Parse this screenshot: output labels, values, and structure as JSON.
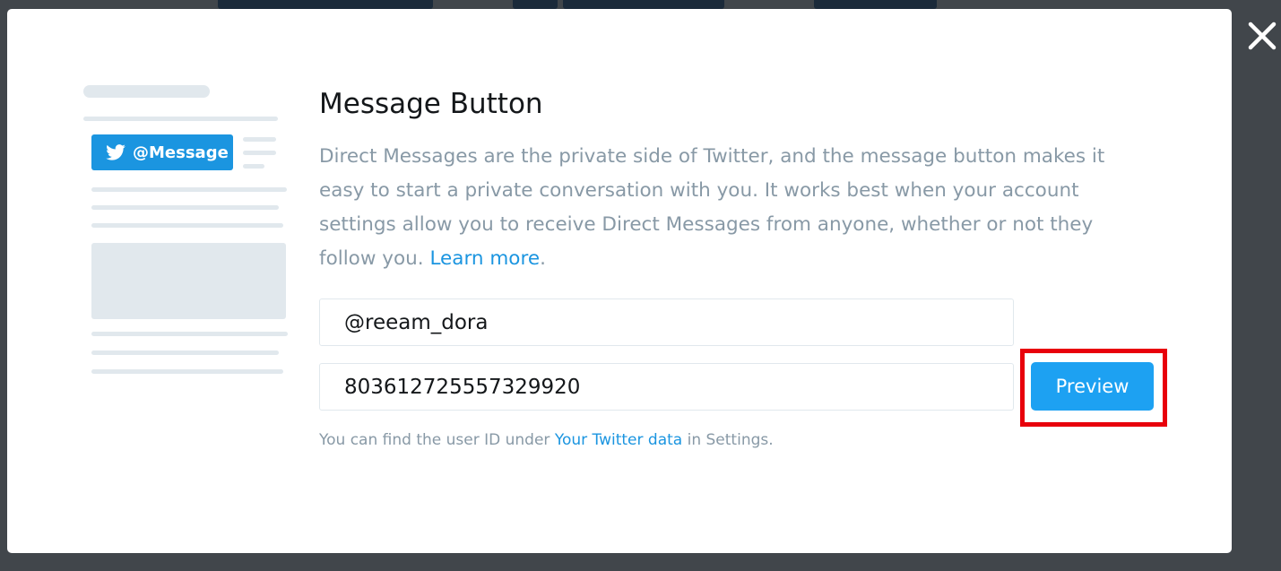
{
  "modal": {
    "title": "Message Button",
    "description": "Direct Messages are the private side of Twitter, and the message button makes it easy to start a private conversation with you. It works best when your account settings allow you to receive Direct Messages from anyone, whether or not they follow you.",
    "learn_more_label": "Learn more",
    "close_label": "×",
    "illustration": {
      "button_label": "@Message",
      "icon": "twitter-bird-icon"
    },
    "screen_name_field": {
      "value": "@reeam_dora"
    },
    "user_id_field": {
      "value": "803612725557329920"
    },
    "preview_label": "Preview",
    "hint_prefix": "You can find the user ID under",
    "hint_link": "Your Twitter data",
    "hint_suffix": "in Settings."
  },
  "colors": {
    "accent": "#1da1f2",
    "link": "#1b95e0",
    "highlight": "#e8000b",
    "overlay": "#41464b"
  }
}
